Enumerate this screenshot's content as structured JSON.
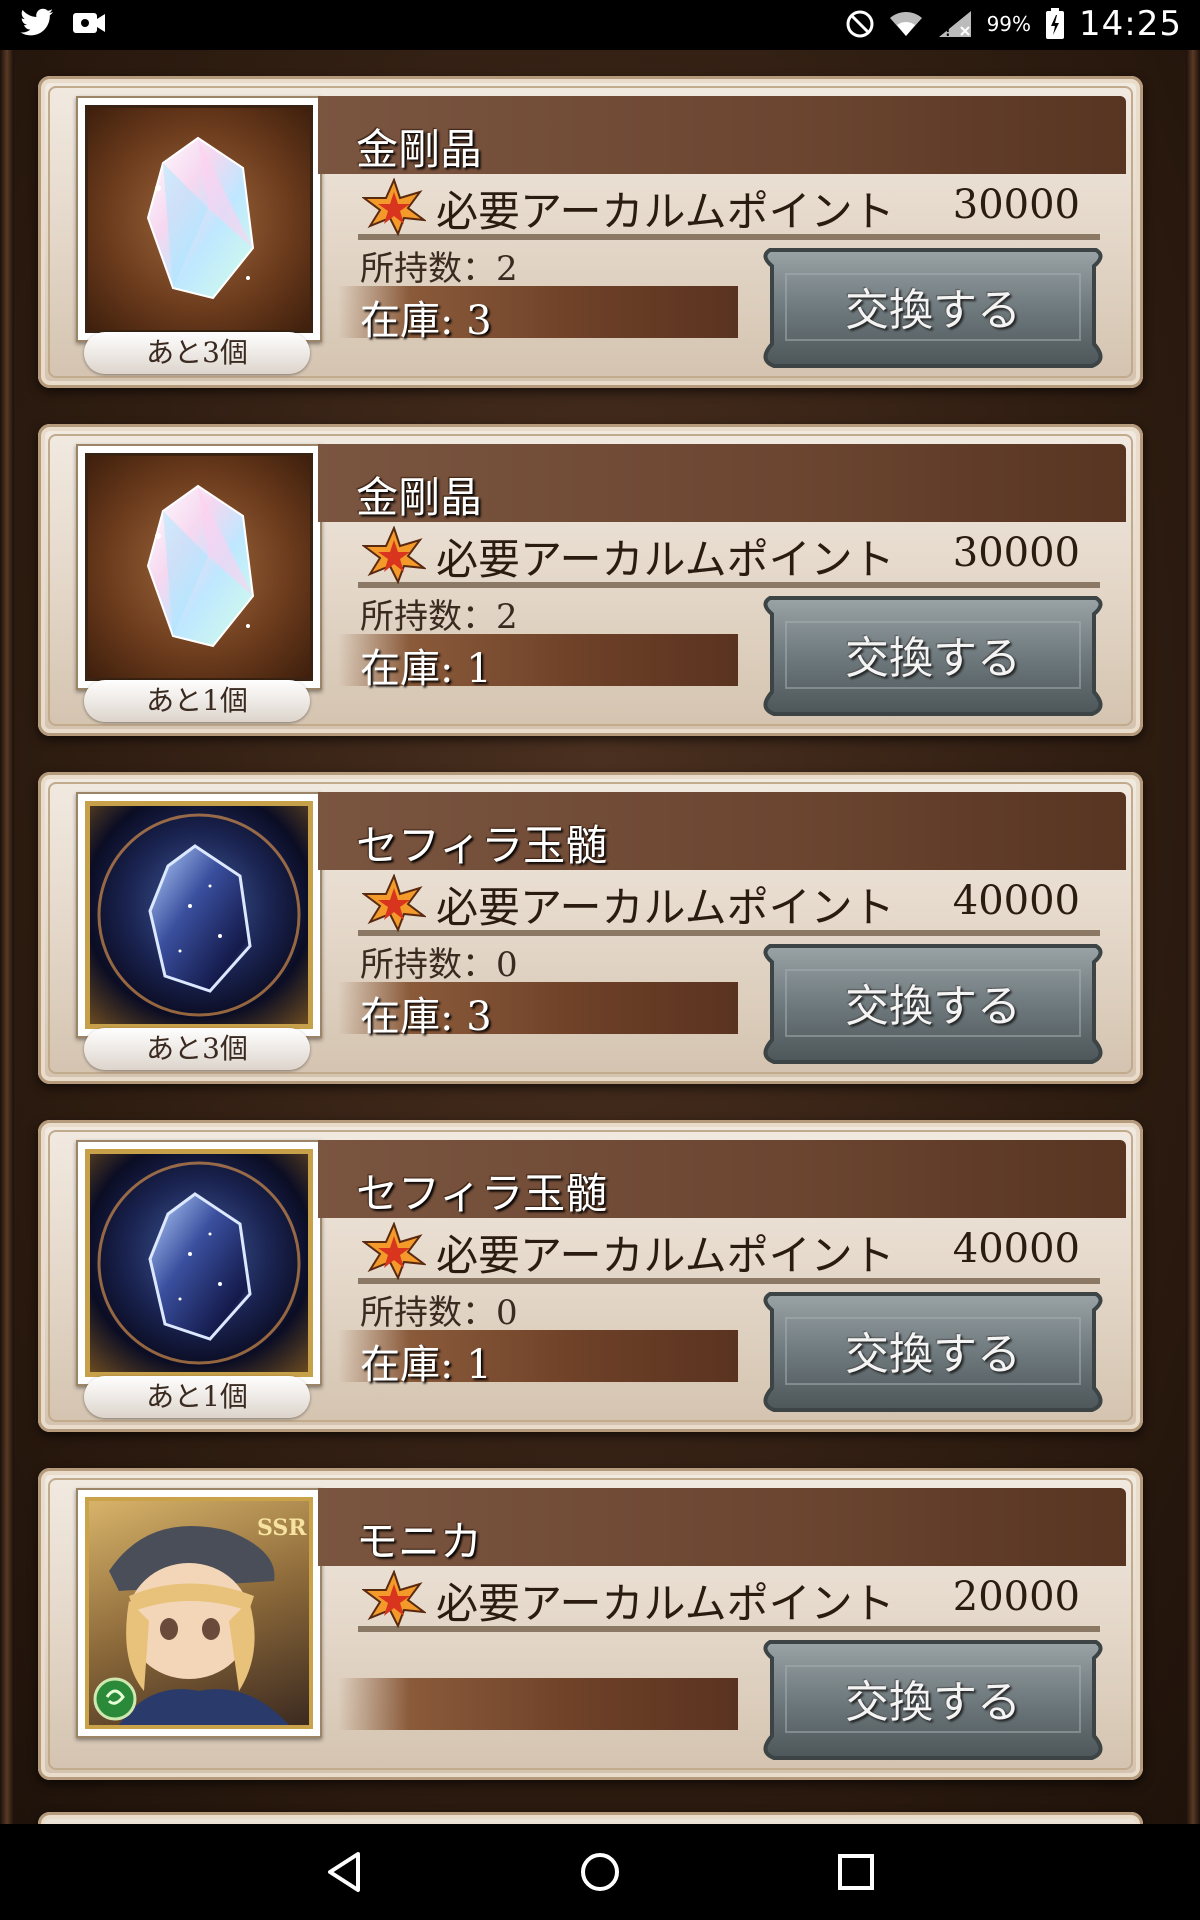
{
  "status_bar": {
    "battery_percent": "99%",
    "time": "14:25",
    "icons": [
      "twitter-icon",
      "video-icon",
      "do-not-disturb-icon",
      "wifi-icon",
      "signal-icon",
      "battery-icon"
    ]
  },
  "items": [
    {
      "name": "金剛晶",
      "required_label": "必要アーカルムポイント",
      "required_value": "30000",
      "owned": "所持数：2",
      "stock": "在庫: 3",
      "remaining": "あと3個",
      "button": "交換する",
      "thumb": "crystal-brown"
    },
    {
      "name": "金剛晶",
      "required_label": "必要アーカルムポイント",
      "required_value": "30000",
      "owned": "所持数：2",
      "stock": "在庫: 1",
      "remaining": "あと1個",
      "button": "交換する",
      "thumb": "crystal-brown"
    },
    {
      "name": "セフィラ玉髄",
      "required_label": "必要アーカルムポイント",
      "required_value": "40000",
      "owned": "所持数：0",
      "stock": "在庫: 3",
      "remaining": "あと3個",
      "button": "交換する",
      "thumb": "crystal-blue"
    },
    {
      "name": "セフィラ玉髄",
      "required_label": "必要アーカルムポイント",
      "required_value": "40000",
      "owned": "所持数：0",
      "stock": "在庫: 1",
      "remaining": "あと1個",
      "button": "交換する",
      "thumb": "crystal-blue"
    },
    {
      "name": "モニカ",
      "required_label": "必要アーカルムポイント",
      "required_value": "20000",
      "owned": "",
      "stock": "",
      "remaining": "",
      "button": "交換する",
      "thumb": "character-portrait",
      "rarity": "SSR"
    }
  ],
  "nav_bar": {
    "icons": [
      "back-icon",
      "home-icon",
      "recents-icon"
    ]
  }
}
